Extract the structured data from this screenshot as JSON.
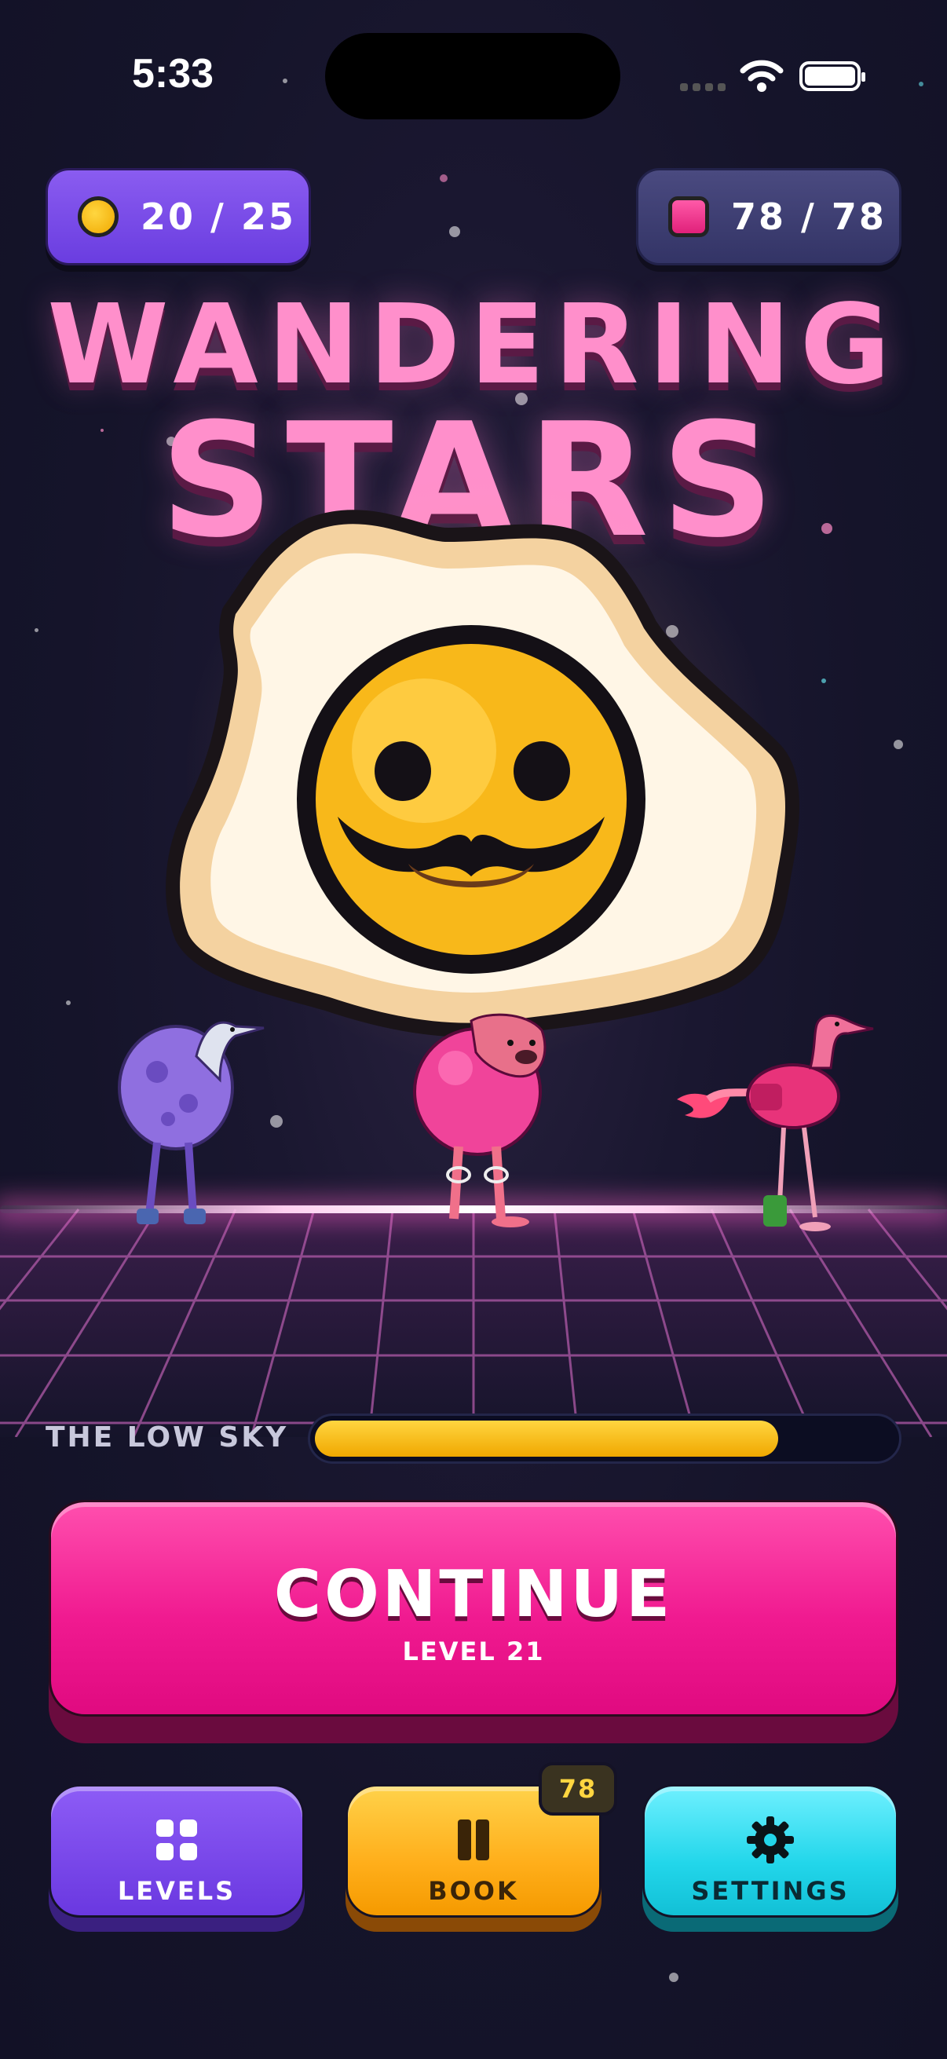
{
  "status_bar": {
    "time": "5:33"
  },
  "currency": {
    "coins": {
      "label": "20 / 25",
      "icon": "coin-icon",
      "color": "#ffc61a"
    },
    "gems": {
      "label": "78 / 78",
      "icon": "gem-icon",
      "color": "#ff3a9a"
    }
  },
  "title": {
    "line1": "WANDERING",
    "line2": "STARS"
  },
  "characters": [
    "egg-mustache-hero",
    "purple-heron-blob",
    "pink-pug-ball",
    "pink-flamingo-hairdryer"
  ],
  "progress": {
    "label": "THE LOW SKY",
    "fraction": 0.8
  },
  "continue_button": {
    "label": "CONTINUE",
    "sublabel": "LEVEL 21"
  },
  "nav_buttons": {
    "levels": {
      "label": "LEVELS",
      "icon": "grid-icon"
    },
    "book": {
      "label": "BOOK",
      "icon": "book-icon",
      "badge": "78"
    },
    "settings": {
      "label": "SETTINGS",
      "icon": "gear-icon"
    }
  },
  "colors": {
    "title_pink": "#ff8fcb",
    "continue_pink": "#f01a90",
    "levels_purple": "#7c4cf0",
    "book_yellow": "#ffae1a",
    "settings_cyan": "#22d6ea",
    "progress_yellow": "#ffc61a"
  }
}
